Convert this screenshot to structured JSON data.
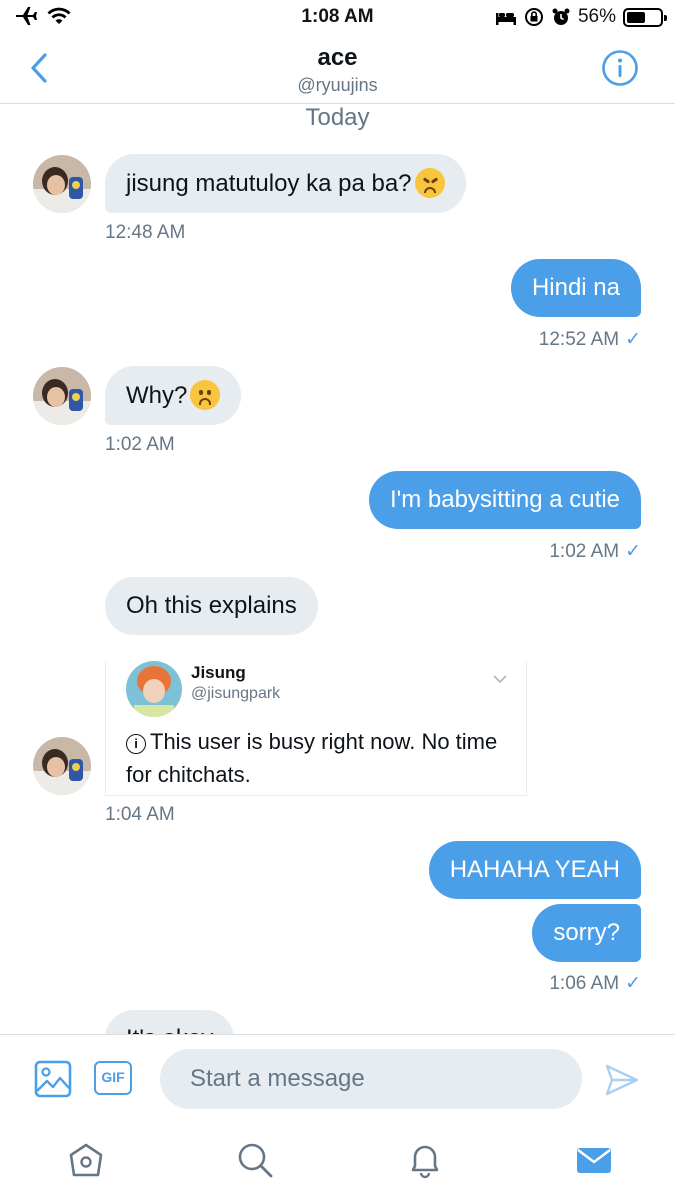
{
  "status_bar": {
    "time": "1:08 AM",
    "battery_text": "56%",
    "battery_level": 0.56
  },
  "header": {
    "title": "ace",
    "handle": "@ryuujins",
    "back_icon": "chevron-left-icon",
    "info_icon": "info-icon"
  },
  "chat": {
    "day_label": "Today",
    "messages": [
      {
        "dir": "in",
        "text": "jisung matutuloy ka pa ba?",
        "emoji": "persevering-face-emoji",
        "time": "12:48 AM"
      },
      {
        "dir": "out",
        "text": "Hindi na",
        "time": "12:52 AM"
      },
      {
        "dir": "in",
        "text": "Why?",
        "emoji": "frowning-face-emoji",
        "time": "1:02 AM"
      },
      {
        "dir": "out",
        "text": "I'm babysitting a cutie",
        "time": "1:02 AM"
      },
      {
        "dir": "in",
        "text": "Oh this explains",
        "time": "1:04 AM"
      },
      {
        "dir": "out",
        "text": "HAHAHA YEAH"
      },
      {
        "dir": "out",
        "text": "sorry?",
        "time": "1:06 AM"
      },
      {
        "dir": "in",
        "text": "It's okay"
      }
    ],
    "tweet_card": {
      "name": "Jisung",
      "handle": "@jisungpark",
      "text": "This user is busy right now. No time for chitchats."
    },
    "read_mark": "✓"
  },
  "composer": {
    "gif_label": "GIF",
    "placeholder": "Start a message"
  },
  "colors": {
    "accent": "#4b9ee8",
    "incoming_bubble": "#e6ecf0",
    "secondary_text": "#657786"
  }
}
